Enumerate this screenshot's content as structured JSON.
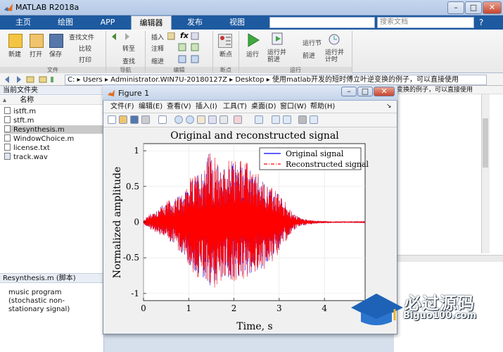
{
  "window": {
    "title": "MATLAB R2018a"
  },
  "tabs": [
    {
      "label": "主页"
    },
    {
      "label": "绘图"
    },
    {
      "label": "APP"
    },
    {
      "label": "编辑器"
    },
    {
      "label": "发布"
    },
    {
      "label": "视图"
    }
  ],
  "search": {
    "placeholder": "搜索文档"
  },
  "ribbon": {
    "file": {
      "new": "新建",
      "open": "打开",
      "save": "保存",
      "find_files": "查找文件",
      "compare": "比较",
      "print": "打印",
      "group": "文件"
    },
    "navigate": {
      "goto": "转至",
      "find": "查找",
      "group": "导航"
    },
    "edit": {
      "insert": "插入",
      "comment": "注释",
      "indent": "缩进",
      "fx": "fx",
      "group": "编辑"
    },
    "breakpoints": {
      "label": "断点",
      "group": "断点"
    },
    "run": {
      "run": "运行",
      "run_advance": "运行并\n前进",
      "run_section": "运行节",
      "advance": "前进",
      "run_time": "运行并\n计时",
      "group": "运行"
    }
  },
  "address": {
    "segments": [
      "C:",
      "Users",
      "Administrator.WIN7U-20180127Z",
      "Desktop",
      "使用matlab开发的短时傅立叶逆变换的例子，可以直接使用"
    ]
  },
  "left_panel": {
    "title": "当前文件夹",
    "column": "名称",
    "files": [
      "istft.m",
      "stft.m",
      "Resynthesis.m",
      "WindowChoice.m",
      "license.txt",
      "track.wav"
    ],
    "selected": "Resynthesis.m",
    "details_title": "Resynthesis.m  (脚本)",
    "details_text": "music program (stochastic non-stationary signal)"
  },
  "right_panel": {
    "path_text": "变换的例子，可以直接使用"
  },
  "figure": {
    "title": "Figure 1",
    "menu": [
      "文件(F)",
      "编辑(E)",
      "查看(V)",
      "插入(I)",
      "工具(T)",
      "桌面(D)",
      "窗口(W)",
      "帮助(H)"
    ]
  },
  "chart_data": {
    "type": "line",
    "title": "Original and reconstructed signal",
    "xlabel": "Time, s",
    "ylabel": "Normalized amplitude",
    "xlim": [
      0,
      4.9
    ],
    "ylim": [
      -1.1,
      1.1
    ],
    "xticks": [
      0,
      1,
      2,
      3,
      4
    ],
    "yticks": [
      -1,
      -0.5,
      0,
      0.5,
      1
    ],
    "grid": true,
    "legend_position": "top-right",
    "series": [
      {
        "name": "Original signal",
        "color": "#0000ff",
        "style": "solid"
      },
      {
        "name": "Reconstructed signal",
        "color": "#ff0000",
        "style": "dash-dot"
      }
    ],
    "envelope": {
      "t": [
        0,
        0.1,
        0.3,
        0.5,
        0.7,
        0.9,
        1.1,
        1.3,
        1.45,
        1.6,
        1.8,
        2.0,
        2.2,
        2.4,
        2.6,
        2.8,
        2.95,
        3.1,
        3.3,
        3.5,
        3.8,
        4.2,
        4.9
      ],
      "upper": [
        0.02,
        0.1,
        0.18,
        0.28,
        0.32,
        0.45,
        0.62,
        0.75,
        0.98,
        0.82,
        0.78,
        0.85,
        0.88,
        0.72,
        0.6,
        0.5,
        0.42,
        0.3,
        0.12,
        0.05,
        0.02,
        0.01,
        0.005
      ],
      "lower": [
        -0.02,
        -0.08,
        -0.15,
        -0.22,
        -0.34,
        -0.48,
        -0.7,
        -0.82,
        -0.96,
        -0.85,
        -0.8,
        -0.82,
        -0.78,
        -0.7,
        -0.66,
        -0.55,
        -0.45,
        -0.3,
        -0.12,
        -0.05,
        -0.02,
        -0.01,
        -0.005
      ]
    }
  },
  "watermark": {
    "title": "必过源码",
    "subtitle": "Biguo100.com"
  },
  "colors": {
    "accent": "#1e5aa0",
    "signal_blue": "#0000ff",
    "signal_red": "#ff0000"
  }
}
